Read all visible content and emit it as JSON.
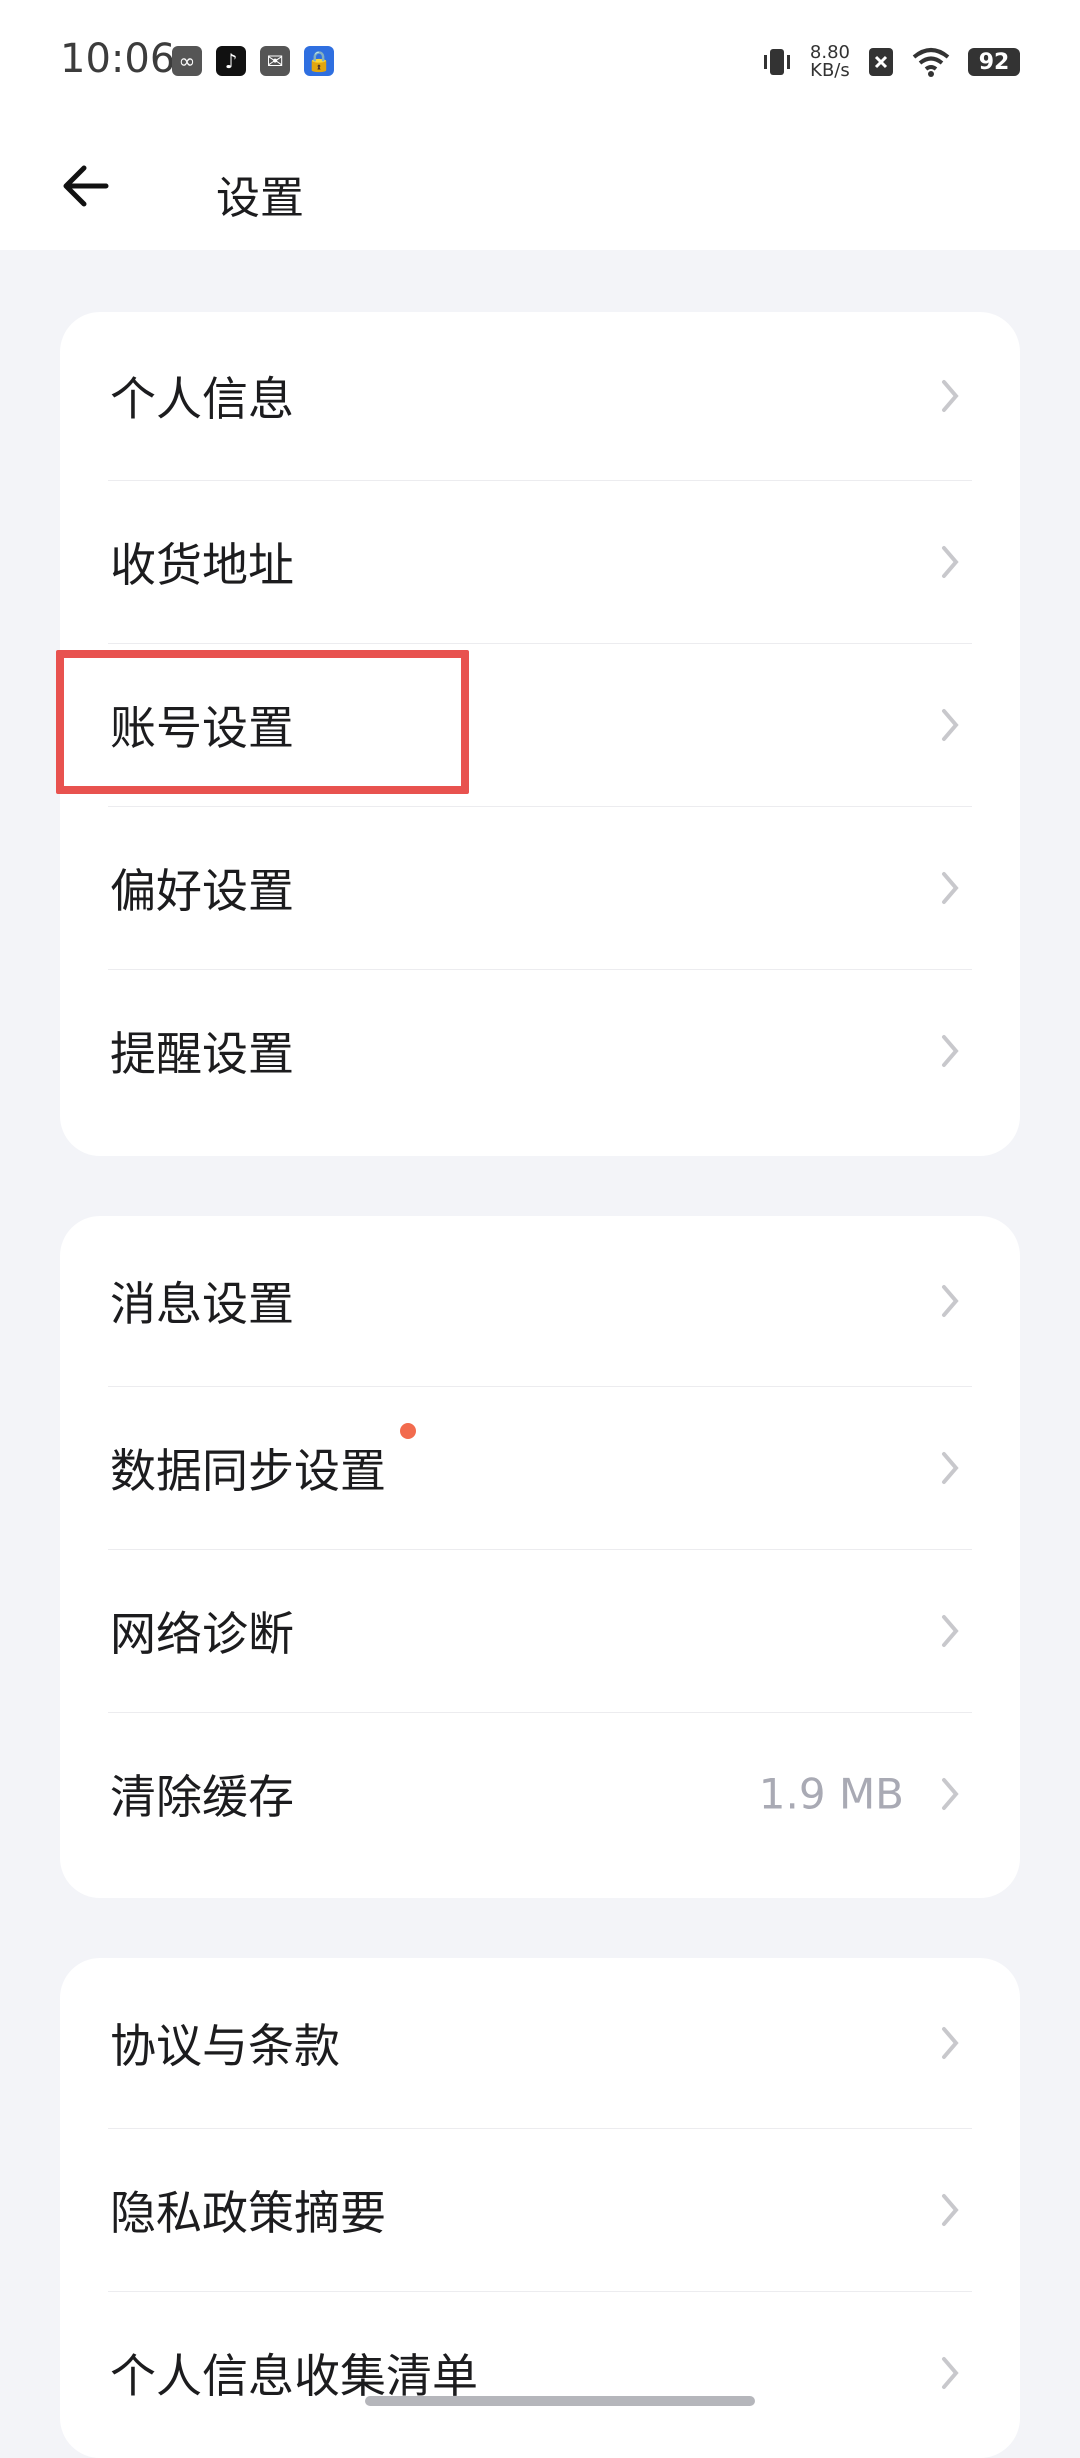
{
  "status_bar": {
    "time": "10:06",
    "net_speed_value": "8.80",
    "net_speed_unit": "KB/s",
    "battery": "92",
    "app_icons": [
      "link-icon",
      "tiktok-icon",
      "mail-icon",
      "lock-icon"
    ]
  },
  "header": {
    "back_icon": "arrow-left-icon",
    "title": "设置"
  },
  "groups": [
    {
      "items": [
        {
          "label": "个人信息"
        },
        {
          "label": "收货地址"
        },
        {
          "label": "账号设置"
        },
        {
          "label": "偏好设置"
        },
        {
          "label": "提醒设置"
        }
      ]
    },
    {
      "items": [
        {
          "label": "消息设置"
        },
        {
          "label": "数据同步设置",
          "badge": "red-dot"
        },
        {
          "label": "网络诊断"
        },
        {
          "label": "清除缓存",
          "value": "1.9 MB"
        }
      ]
    },
    {
      "items": [
        {
          "label": "协议与条款"
        },
        {
          "label": "隐私政策摘要"
        },
        {
          "label": "个人信息收集清单"
        }
      ]
    }
  ],
  "colors": {
    "highlight": "#e8524f",
    "badge": "#f26b4e",
    "background": "#f3f4f8",
    "value_text": "#a9aab4"
  }
}
